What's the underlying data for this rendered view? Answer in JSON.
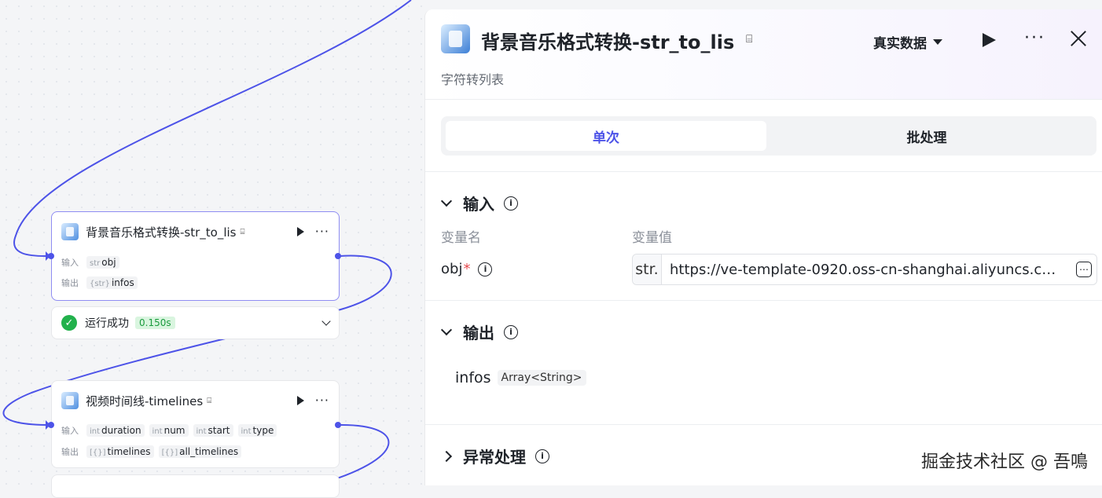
{
  "canvas": {
    "nodes": [
      {
        "title": "背景音乐格式转换-str_to_lis",
        "input_label": "输入",
        "output_label": "输出",
        "inputs": [
          {
            "type": "str",
            "name": "obj"
          }
        ],
        "outputs": [
          {
            "type": "{str}",
            "name": "infos"
          }
        ],
        "status": {
          "text": "运行成功",
          "time": "0.150s"
        }
      },
      {
        "title": "视频时间线-timelines",
        "input_label": "输入",
        "output_label": "输出",
        "inputs": [
          {
            "type": "int",
            "name": "duration"
          },
          {
            "type": "int",
            "name": "num"
          },
          {
            "type": "int",
            "name": "start"
          },
          {
            "type": "int",
            "name": "type"
          }
        ],
        "outputs": [
          {
            "type": "[{}]",
            "name": "timelines"
          },
          {
            "type": "[{}]",
            "name": "all_timelines"
          }
        ]
      }
    ]
  },
  "panel": {
    "title": "背景音乐格式转换-str_to_lis",
    "subtitle": "字符转列表",
    "mode": "真实数据",
    "tabs": [
      "单次",
      "批处理"
    ],
    "input_section": {
      "title": "输入",
      "col_name": "变量名",
      "col_value": "变量值",
      "var": {
        "name": "obj",
        "required_mark": "*",
        "type": "str.",
        "value": "https://ve-template-0920.oss-cn-shanghai.aliyuncs.co…"
      }
    },
    "output_section": {
      "title": "输出",
      "var": {
        "name": "infos",
        "type": "Array<String>"
      }
    },
    "error_section": {
      "title": "异常处理"
    }
  },
  "watermark": "掘金技术社区 @ 吾鳴",
  "colors": {
    "accent": "#4d53e8",
    "success": "#22b14c",
    "edge": "#4d53e8"
  }
}
